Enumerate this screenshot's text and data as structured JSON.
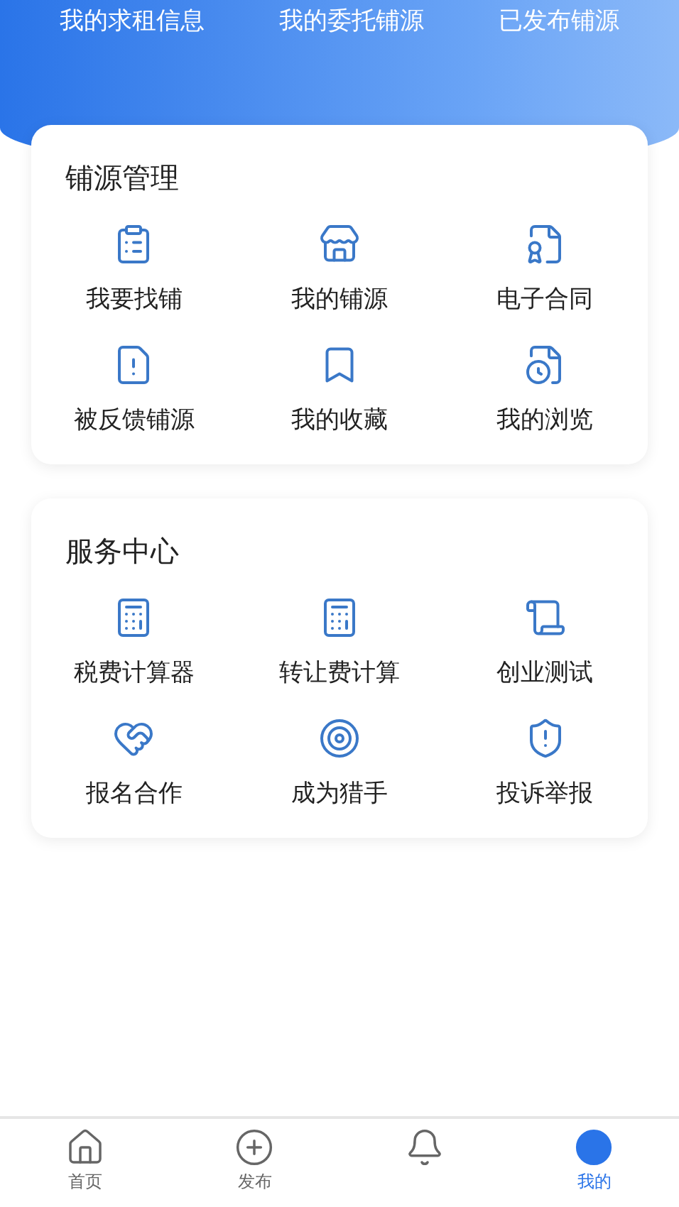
{
  "header_tabs": [
    {
      "label": "我的求租信息"
    },
    {
      "label": "我的委托铺源"
    },
    {
      "label": "已发布铺源"
    }
  ],
  "sections": [
    {
      "title": "铺源管理",
      "items": [
        {
          "kind": "clipboard",
          "label": "我要找铺"
        },
        {
          "kind": "store",
          "label": "我的铺源"
        },
        {
          "kind": "contract",
          "label": "电子合同"
        },
        {
          "kind": "report",
          "label": "被反馈铺源"
        },
        {
          "kind": "bookmark",
          "label": "我的收藏"
        },
        {
          "kind": "history",
          "label": "我的浏览"
        }
      ]
    },
    {
      "title": "服务中心",
      "items": [
        {
          "kind": "calculator",
          "label": "税费计算器"
        },
        {
          "kind": "fee",
          "label": "转让费计算"
        },
        {
          "kind": "scroll",
          "label": "创业测试"
        },
        {
          "kind": "handshake",
          "label": "报名合作"
        },
        {
          "kind": "target",
          "label": "成为猎手"
        },
        {
          "kind": "shield",
          "label": "投诉举报"
        }
      ]
    }
  ],
  "bottom_nav": [
    {
      "kind": "home",
      "label": "首页",
      "selected": false
    },
    {
      "kind": "plus",
      "label": "发布",
      "selected": false
    },
    {
      "kind": "bell",
      "selected": false
    },
    {
      "kind": "me",
      "label": "我的",
      "selected": true
    }
  ]
}
